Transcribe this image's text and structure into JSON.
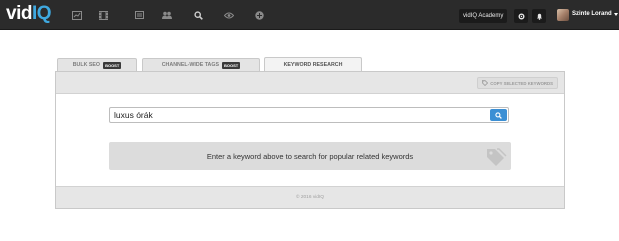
{
  "app": {
    "logo_text_1": "vid",
    "logo_text_2": "IQ",
    "brand_color": "#3fa9e0"
  },
  "topbar": {
    "nav_icons": [
      "chart-icon",
      "film-icon",
      "list-icon",
      "users-icon",
      "search-icon",
      "eye-icon",
      "plus-circle-icon"
    ],
    "academy_label": "vidIQ Academy",
    "settings_icon": "gear-icon",
    "notifications_icon": "bell-icon",
    "username": "Szinte Lorand"
  },
  "tabs": [
    {
      "label": "BULK SEO",
      "badge": "BOOST",
      "active": false
    },
    {
      "label": "CHANNEL-WIDE TAGS",
      "badge": "BOOST",
      "active": false
    },
    {
      "label": "KEYWORD RESEARCH",
      "badge": "",
      "active": true
    }
  ],
  "panel": {
    "copy_button_label": "COPY SELECTED KEYWORDS",
    "search": {
      "value": "luxus órák",
      "placeholder": ""
    },
    "hint_text": "Enter a keyword above to search for popular related keywords",
    "footer_text": "© 2016 vidIQ"
  },
  "colors": {
    "topbar_bg": "#2b2b2b",
    "search_button": "#3b8fd4"
  }
}
